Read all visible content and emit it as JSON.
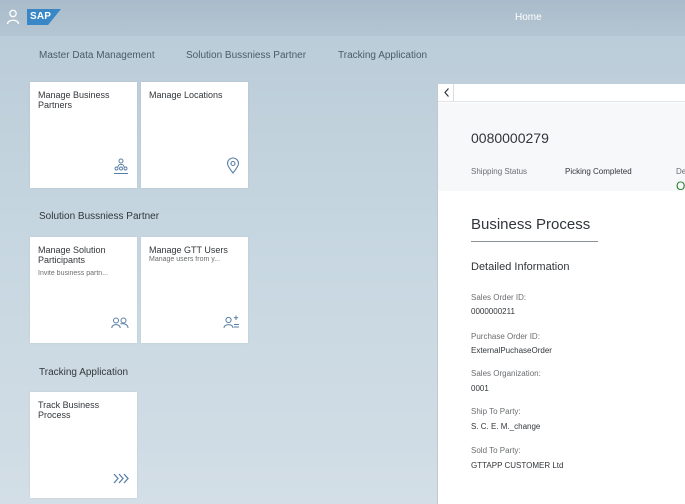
{
  "shell": {
    "brand": "SAP",
    "title": "Home"
  },
  "tabs": [
    {
      "label": "Master Data Management"
    },
    {
      "label": "Solution Bussniess Partner"
    },
    {
      "label": "Tracking Application"
    }
  ],
  "groups": {
    "solution_partner": "Solution Bussniess Partner",
    "tracking_app": "Tracking Application"
  },
  "tiles": {
    "manage_business_partners": {
      "title": "Manage Business Partners",
      "icon": "people-group-icon"
    },
    "manage_locations": {
      "title": "Manage Locations",
      "icon": "map-pin-icon"
    },
    "manage_solution_participants": {
      "title": "Manage Solution Participants",
      "subtitle": "Invite business partn...",
      "icon": "group-icon"
    },
    "manage_gtt_users": {
      "title": "Manage GTT Users",
      "subtitle": "Manage users from y...",
      "icon": "add-user-icon"
    },
    "track_business_process": {
      "title": "Track Business Process",
      "icon": "chevrons-right-icon"
    }
  },
  "detail": {
    "object_id": "0080000279",
    "shipping_status_label": "Shipping Status",
    "shipping_status_value": "Picking Completed",
    "cut_label": "De",
    "cut_value": "O",
    "section_title": "Business Process",
    "subsection_title": "Detailed Information",
    "fields": [
      {
        "label": "Sales Order ID:",
        "value": "0000000211"
      },
      {
        "label": "Purchase Order ID:",
        "value": "ExternalPuchaseOrder"
      },
      {
        "label": "Sales Organization:",
        "value": "0001"
      },
      {
        "label": "Ship To Party:",
        "value": "S. C. E. M._change"
      },
      {
        "label": "Sold To Party:",
        "value": "GTTAPP CUSTOMER Ltd"
      }
    ]
  },
  "colors": {
    "brand_blue": "#3a87c8",
    "status_green": "#2b7d2b",
    "tile_icon_blue": "#5a7fa6"
  }
}
